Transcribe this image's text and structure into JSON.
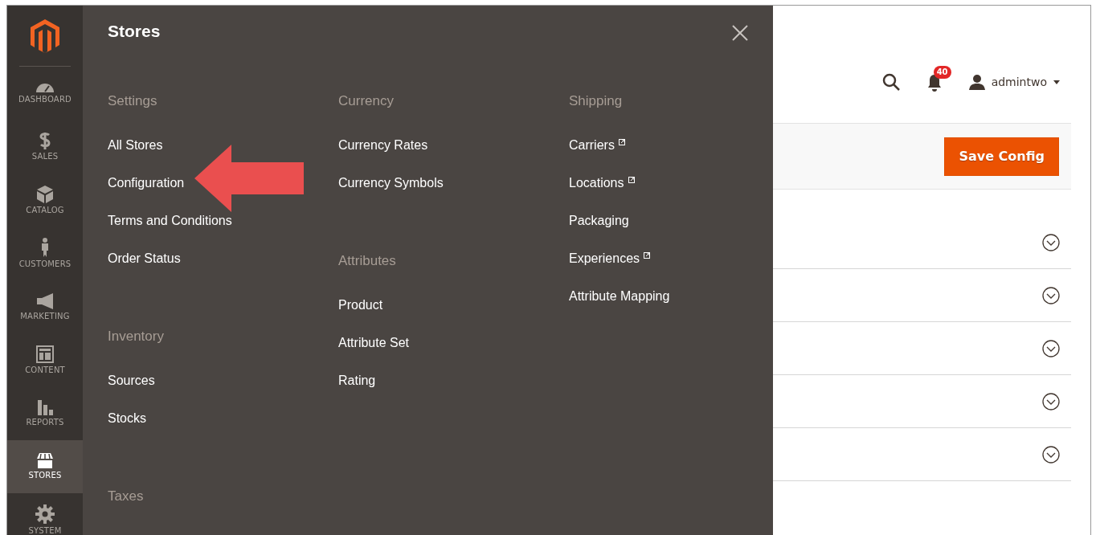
{
  "sidebar": {
    "items": [
      {
        "kind": "dashboard",
        "label": "DASHBOARD",
        "selected": false
      },
      {
        "kind": "sales",
        "label": "SALES",
        "selected": false
      },
      {
        "kind": "catalog",
        "label": "CATALOG",
        "selected": false
      },
      {
        "kind": "customers",
        "label": "CUSTOMERS",
        "selected": false
      },
      {
        "kind": "marketing",
        "label": "MARKETING",
        "selected": false
      },
      {
        "kind": "content",
        "label": "CONTENT",
        "selected": false
      },
      {
        "kind": "reports",
        "label": "REPORTS",
        "selected": false
      },
      {
        "kind": "stores",
        "label": "STORES",
        "selected": true
      },
      {
        "kind": "system",
        "label": "SYSTEM",
        "selected": false
      }
    ]
  },
  "menu": {
    "title": "Stores",
    "columns": [
      {
        "groups": [
          {
            "heading": "Settings",
            "items": [
              {
                "label": "All Stores",
                "external": false
              },
              {
                "label": "Configuration",
                "external": false
              },
              {
                "label": "Terms and Conditions",
                "external": false
              },
              {
                "label": "Order Status",
                "external": false
              }
            ]
          },
          {
            "heading": "Inventory",
            "items": [
              {
                "label": "Sources",
                "external": false
              },
              {
                "label": "Stocks",
                "external": false
              }
            ]
          },
          {
            "heading": "Taxes"
          }
        ]
      },
      {
        "groups": [
          {
            "heading": "Currency",
            "items": [
              {
                "label": "Currency Rates",
                "external": false
              },
              {
                "label": "Currency Symbols",
                "external": false
              }
            ]
          },
          {
            "heading": "Attributes",
            "items": [
              {
                "label": "Product",
                "external": false
              },
              {
                "label": "Attribute Set",
                "external": false
              },
              {
                "label": "Rating",
                "external": false
              }
            ]
          }
        ]
      },
      {
        "groups": [
          {
            "heading": "Shipping",
            "items": [
              {
                "label": "Carriers",
                "external": true
              },
              {
                "label": "Locations",
                "external": true
              },
              {
                "label": "Packaging",
                "external": false
              },
              {
                "label": "Experiences",
                "external": true
              },
              {
                "label": "Attribute Mapping",
                "external": false
              }
            ]
          }
        ]
      }
    ]
  },
  "header": {
    "notifications": "40",
    "user": "admintwo"
  },
  "actions": {
    "save_button": "Save Config"
  },
  "sections": [
    {
      "expanded": false
    },
    {
      "expanded": false
    },
    {
      "expanded": false
    },
    {
      "expanded": false
    },
    {
      "expanded": false
    }
  ]
}
